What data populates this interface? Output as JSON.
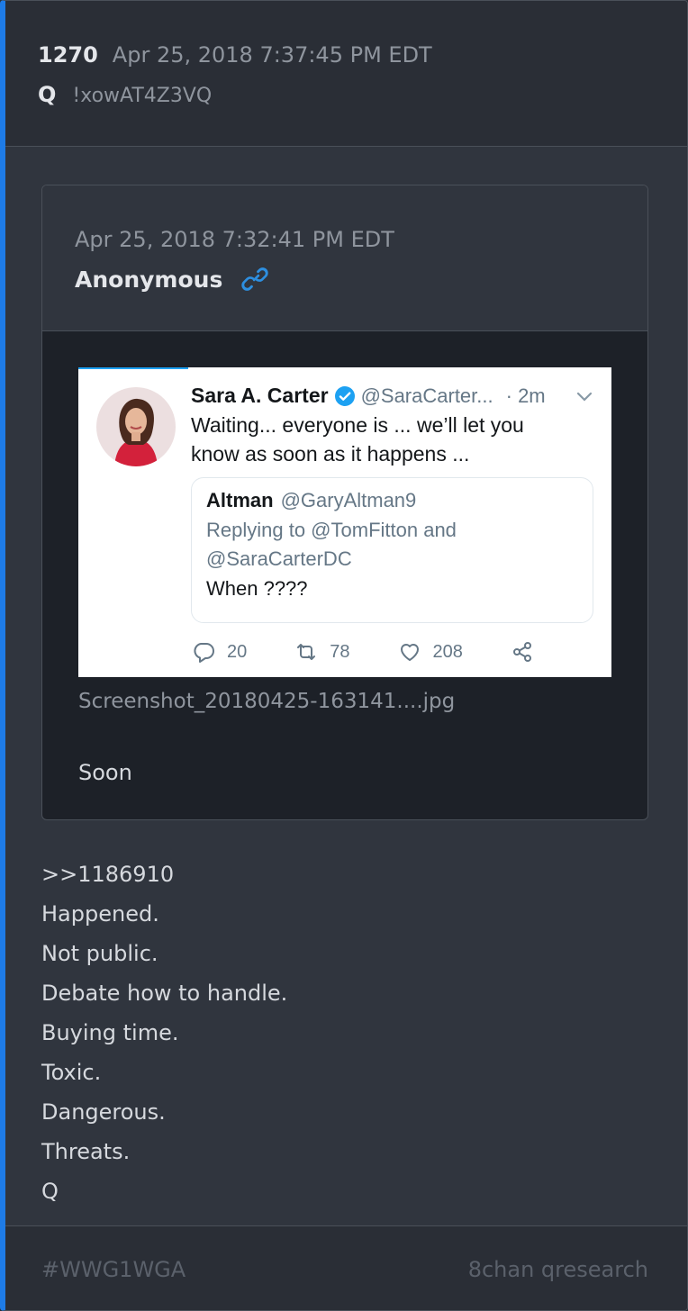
{
  "post": {
    "number": "1270",
    "date": "Apr 25, 2018 7:37:45 PM EDT",
    "author": "Q",
    "tripcode": "!xowAT4Z3VQ",
    "accent_color": "#1e7be6"
  },
  "quoted_post": {
    "date": "Apr 25, 2018 7:32:41 PM EDT",
    "author": "Anonymous",
    "link_icon": "link-icon",
    "attachment_filename": "Screenshot_20180425-163141....jpg",
    "body": "Soon"
  },
  "tweet_screenshot": {
    "name": "Sara A. Carter",
    "handle": "@SaraCarter...",
    "time": "· 2m",
    "text": "Waiting... everyone is ... we’ll let you know as soon as it happens ...",
    "quoted_tweet": {
      "name": "Altman",
      "handle": "@GaryAltman9",
      "reply_to": "Replying to @TomFitton and @SaraCarterDC",
      "text": "When ????"
    },
    "actions": {
      "replies": "20",
      "retweets": "78",
      "likes": "208"
    }
  },
  "body_lines": [
    ">>1186910",
    "Happened.",
    "Not public.",
    "Debate how to handle.",
    "Buying time.",
    "Toxic.",
    "Dangerous.",
    "Threats.",
    "Q"
  ],
  "footer": {
    "hashtag": "#WWG1WGA",
    "board": "8chan qresearch"
  }
}
